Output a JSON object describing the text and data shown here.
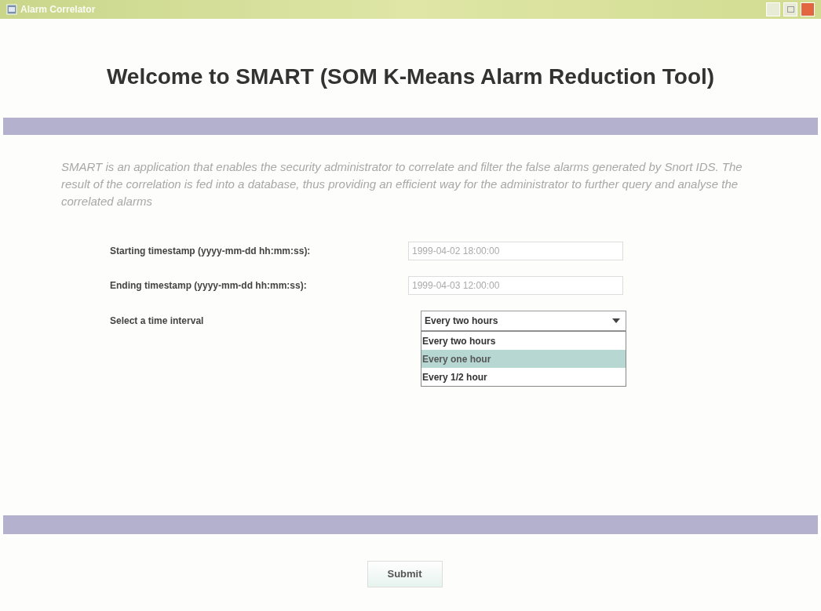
{
  "window": {
    "title": "Alarm Correlator"
  },
  "heading": "Welcome to SMART (SOM K-Means Alarm Reduction Tool)",
  "description": "SMART is an application that enables the security administrator to correlate and filter the false alarms generated by Snort IDS. The result of the correlation is fed into a database, thus providing an efficient way for the administrator to further query and analyse the correlated alarms",
  "fields": [
    {
      "label": "Starting timestamp (yyyy-mm-dd hh:mm:ss):",
      "value": "1999-04-02 18:00:00"
    },
    {
      "label": "Ending timestamp (yyyy-mm-dd hh:mm:ss):",
      "value": "1999-04-03 12:00:00"
    }
  ],
  "interval": {
    "label": "Select a time interval",
    "value": "Every two hours",
    "expanded": true,
    "options": [
      {
        "label": "Every two hours",
        "highlighted": false
      },
      {
        "label": "Every one hour",
        "highlighted": true
      },
      {
        "label": "Every 1/2 hour",
        "highlighted": false
      }
    ]
  },
  "submit": "Submit"
}
